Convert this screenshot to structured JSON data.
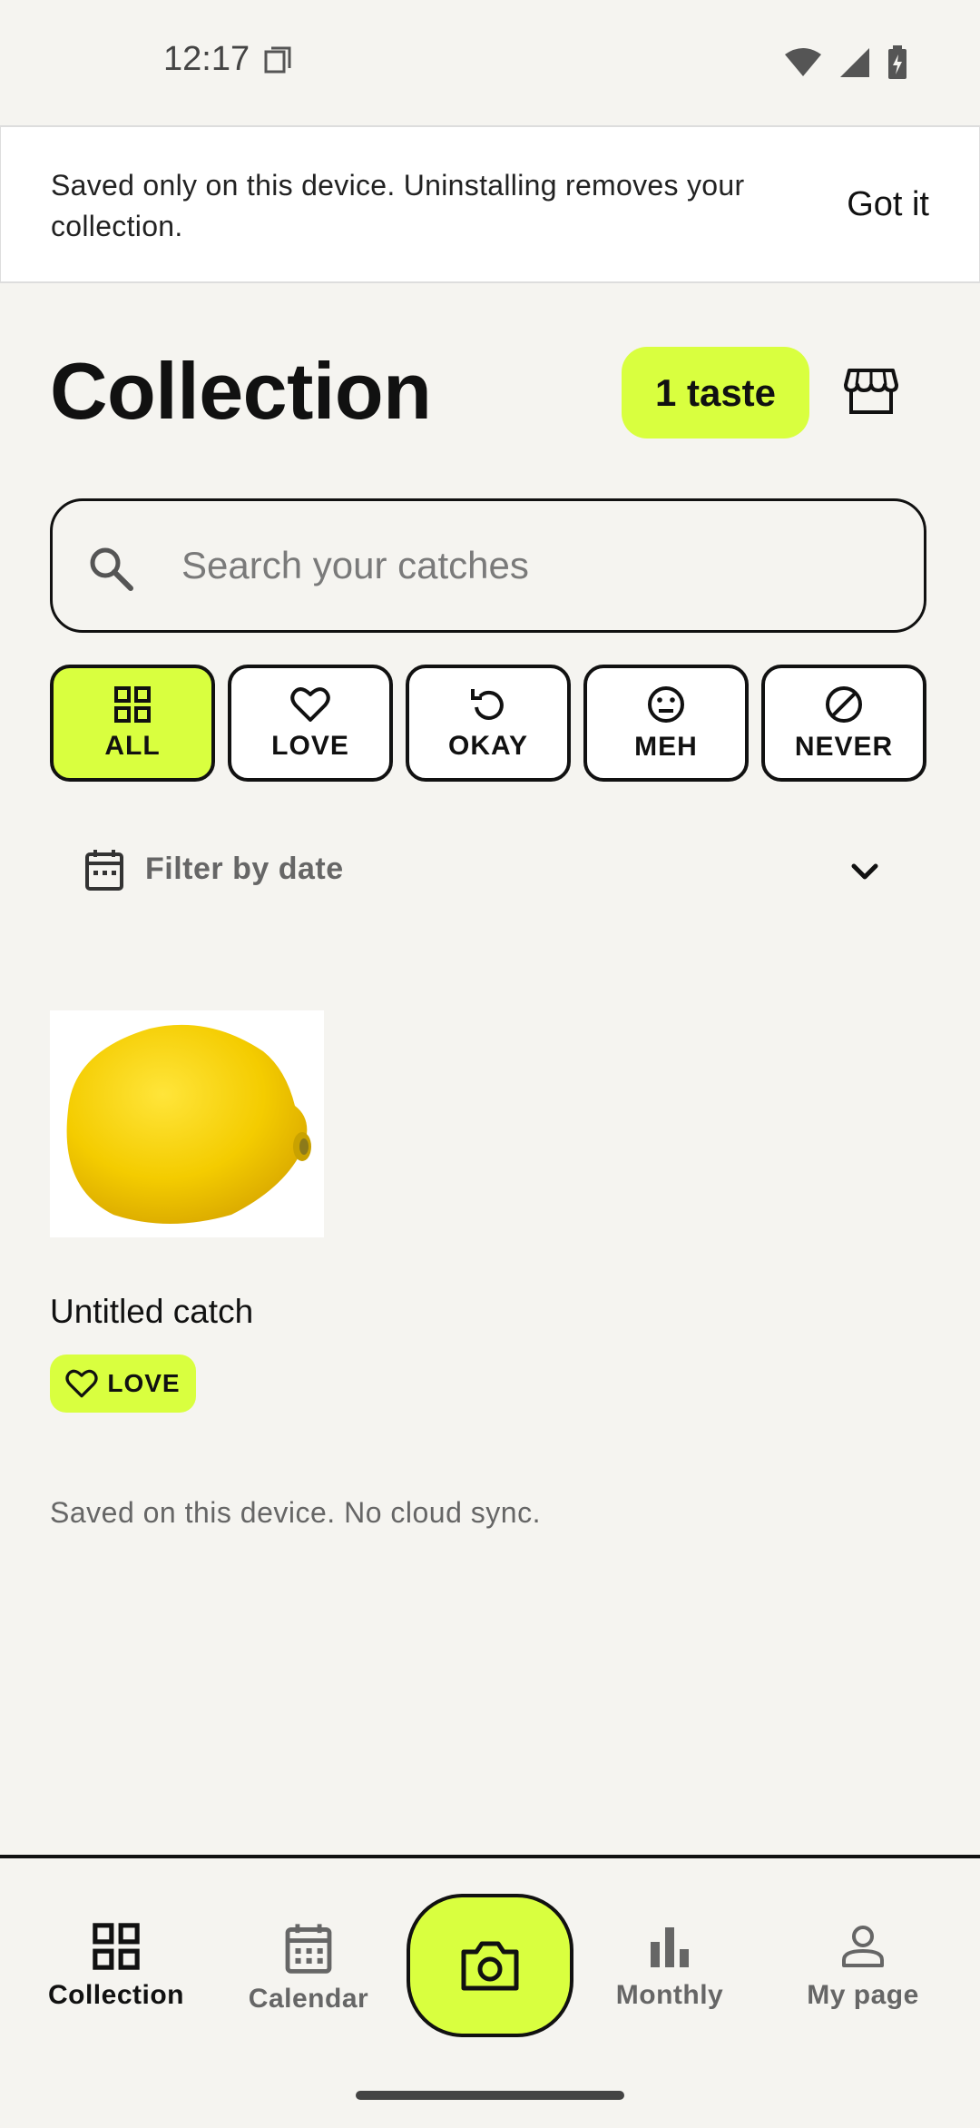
{
  "status_bar": {
    "time": "12:17"
  },
  "notice": {
    "text": "Saved only on this device. Uninstalling removes your collection.",
    "button": "Got it"
  },
  "header": {
    "title": "Collection",
    "taste_badge": "1 taste"
  },
  "search": {
    "placeholder": "Search your catches"
  },
  "filters": {
    "chips": [
      {
        "label": "ALL",
        "icon": "grid-icon",
        "active": true
      },
      {
        "label": "LOVE",
        "icon": "heart-icon",
        "active": false
      },
      {
        "label": "OKAY",
        "icon": "refresh-icon",
        "active": false
      },
      {
        "label": "MEH",
        "icon": "neutral-face-icon",
        "active": false
      },
      {
        "label": "NEVER",
        "icon": "block-icon",
        "active": false
      }
    ],
    "date_filter_label": "Filter by date"
  },
  "catches": [
    {
      "title": "Untitled catch",
      "rating": "LOVE",
      "image": "lemon"
    }
  ],
  "footer_note": "Saved on this device. No cloud sync.",
  "nav": {
    "items": [
      {
        "label": "Collection",
        "icon": "grid-icon",
        "active": true
      },
      {
        "label": "Calendar",
        "icon": "calendar-icon",
        "active": false
      },
      {
        "label": "Monthly",
        "icon": "bar-chart-icon",
        "active": false
      },
      {
        "label": "My page",
        "icon": "person-icon",
        "active": false
      }
    ],
    "camera_icon": "camera-icon"
  },
  "colors": {
    "accent": "#d9ff3f",
    "background": "#f5f4f0",
    "ink": "#111111"
  }
}
